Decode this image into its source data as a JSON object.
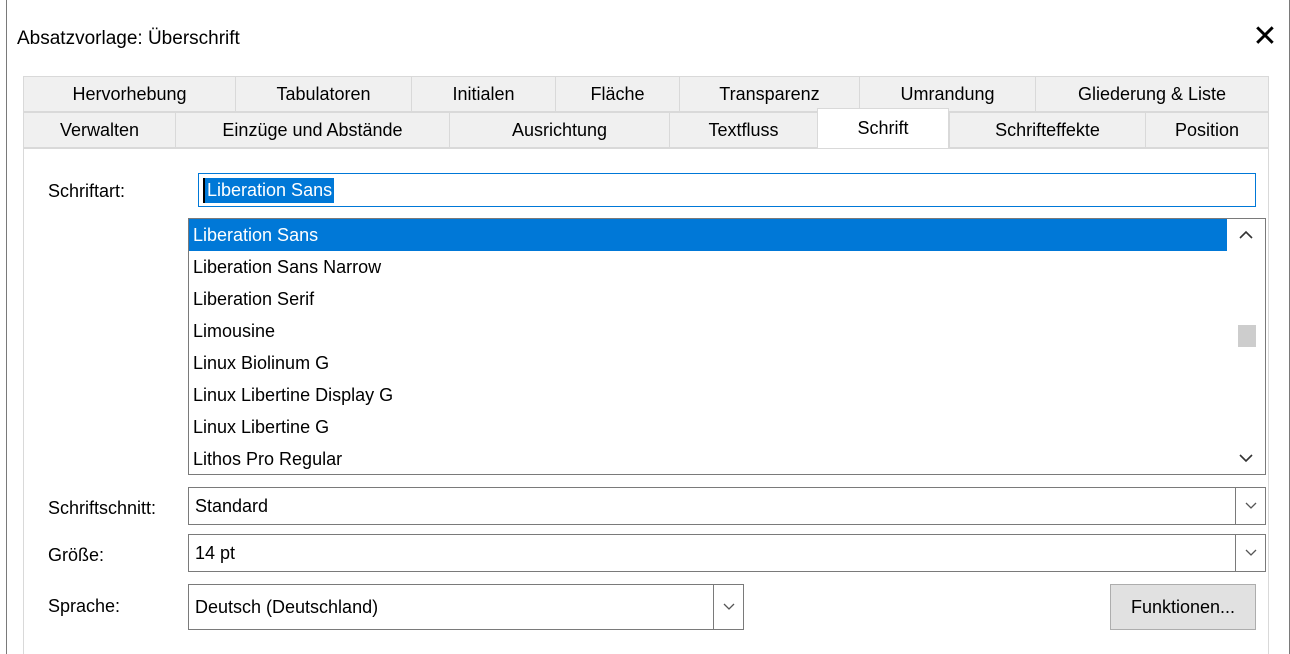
{
  "window": {
    "title": "Absatzvorlage: Überschrift",
    "close_label": "✕"
  },
  "tabs": {
    "row1": [
      "Hervorhebung",
      "Tabulatoren",
      "Initialen",
      "Fläche",
      "Transparenz",
      "Umrandung",
      "Gliederung & Liste"
    ],
    "row2": [
      "Verwalten",
      "Einzüge und Abstände",
      "Ausrichtung",
      "Textfluss",
      "Schrift",
      "Schrifteffekte",
      "Position"
    ],
    "active": "Schrift"
  },
  "font": {
    "label": "Schriftart:",
    "value": "Liberation Sans",
    "list": [
      "Liberation Sans",
      "Liberation Sans Narrow",
      "Liberation Serif",
      "Limousine",
      "Linux Biolinum G",
      "Linux Libertine Display G",
      "Linux Libertine G",
      "Lithos Pro Regular"
    ],
    "selected_index": 0
  },
  "style": {
    "label": "Schriftschnitt:",
    "value": "Standard"
  },
  "size": {
    "label": "Größe:",
    "value": "14 pt"
  },
  "language": {
    "label": "Sprache:",
    "value": "Deutsch (Deutschland)"
  },
  "features_button": "Funktionen...",
  "icons": {
    "close": "close-icon",
    "scroll_up": "chevron-up-icon",
    "scroll_down": "chevron-down-icon",
    "dropdown": "chevron-down-icon"
  },
  "colors": {
    "accent": "#0078d7",
    "tab_bg": "#f0f0f0",
    "button_bg": "#e1e1e1"
  }
}
